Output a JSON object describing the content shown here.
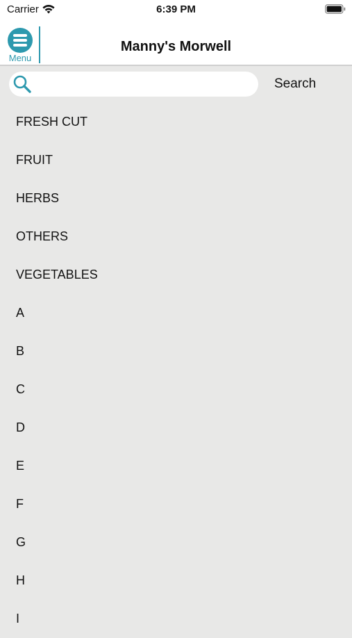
{
  "status_bar": {
    "carrier": "Carrier",
    "time": "6:39 PM",
    "wifi_icon": "wifi-icon",
    "battery_icon": "battery-icon"
  },
  "header": {
    "title": "Manny's Morwell",
    "menu_label": "Menu",
    "menu_icon": "hamburger-menu-icon",
    "accent_color": "#2d99ae"
  },
  "search": {
    "placeholder": "",
    "value": "",
    "button_label": "Search",
    "icon": "search-icon"
  },
  "categories": [
    "FRESH CUT",
    "FRUIT",
    "HERBS",
    "OTHERS",
    "VEGETABLES",
    "A",
    "B",
    "C",
    "D",
    "E",
    "F",
    "G",
    "H",
    "I"
  ],
  "colors": {
    "background": "#e8e8e7",
    "header_background": "#ffffff",
    "accent": "#2d99ae"
  }
}
